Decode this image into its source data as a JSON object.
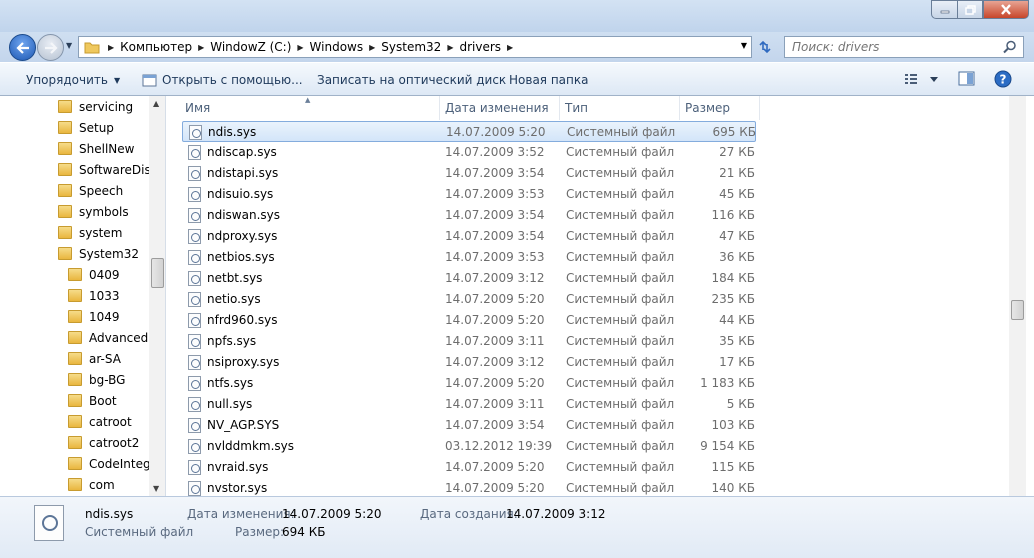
{
  "address": {
    "crumbs": [
      "Компьютер",
      "WindowZ (C:)",
      "Windows",
      "System32",
      "drivers"
    ]
  },
  "search": {
    "placeholder": "Поиск: drivers"
  },
  "toolbar": {
    "organize_label": "Упорядочить",
    "open_with_label": "Открыть с помощью...",
    "burn_label": "Записать на оптический диск",
    "new_folder_label": "Новая папка"
  },
  "nav_tree": [
    {
      "label": "servicing",
      "depth": 0
    },
    {
      "label": "Setup",
      "depth": 0
    },
    {
      "label": "ShellNew",
      "depth": 0
    },
    {
      "label": "SoftwareDistr",
      "depth": 0
    },
    {
      "label": "Speech",
      "depth": 0
    },
    {
      "label": "symbols",
      "depth": 0
    },
    {
      "label": "system",
      "depth": 0
    },
    {
      "label": "System32",
      "depth": 0
    },
    {
      "label": "0409",
      "depth": 1
    },
    {
      "label": "1033",
      "depth": 1
    },
    {
      "label": "1049",
      "depth": 1
    },
    {
      "label": "AdvancedIr",
      "depth": 1
    },
    {
      "label": "ar-SA",
      "depth": 1
    },
    {
      "label": "bg-BG",
      "depth": 1
    },
    {
      "label": "Boot",
      "depth": 1
    },
    {
      "label": "catroot",
      "depth": 1
    },
    {
      "label": "catroot2",
      "depth": 1
    },
    {
      "label": "CodeIntegr",
      "depth": 1
    },
    {
      "label": "com",
      "depth": 1
    }
  ],
  "columns": {
    "name": "Имя",
    "date": "Дата изменения",
    "type": "Тип",
    "size": "Размер"
  },
  "files": [
    {
      "name": "ndis.sys",
      "date": "14.07.2009 5:20",
      "type": "Системный файл",
      "size": "695 КБ",
      "selected": true
    },
    {
      "name": "ndiscap.sys",
      "date": "14.07.2009 3:52",
      "type": "Системный файл",
      "size": "27 КБ"
    },
    {
      "name": "ndistapi.sys",
      "date": "14.07.2009 3:54",
      "type": "Системный файл",
      "size": "21 КБ"
    },
    {
      "name": "ndisuio.sys",
      "date": "14.07.2009 3:53",
      "type": "Системный файл",
      "size": "45 КБ"
    },
    {
      "name": "ndiswan.sys",
      "date": "14.07.2009 3:54",
      "type": "Системный файл",
      "size": "116 КБ"
    },
    {
      "name": "ndproxy.sys",
      "date": "14.07.2009 3:54",
      "type": "Системный файл",
      "size": "47 КБ"
    },
    {
      "name": "netbios.sys",
      "date": "14.07.2009 3:53",
      "type": "Системный файл",
      "size": "36 КБ"
    },
    {
      "name": "netbt.sys",
      "date": "14.07.2009 3:12",
      "type": "Системный файл",
      "size": "184 КБ"
    },
    {
      "name": "netio.sys",
      "date": "14.07.2009 5:20",
      "type": "Системный файл",
      "size": "235 КБ"
    },
    {
      "name": "nfrd960.sys",
      "date": "14.07.2009 5:20",
      "type": "Системный файл",
      "size": "44 КБ"
    },
    {
      "name": "npfs.sys",
      "date": "14.07.2009 3:11",
      "type": "Системный файл",
      "size": "35 КБ"
    },
    {
      "name": "nsiproxy.sys",
      "date": "14.07.2009 3:12",
      "type": "Системный файл",
      "size": "17 КБ"
    },
    {
      "name": "ntfs.sys",
      "date": "14.07.2009 5:20",
      "type": "Системный файл",
      "size": "1 183 КБ"
    },
    {
      "name": "null.sys",
      "date": "14.07.2009 3:11",
      "type": "Системный файл",
      "size": "5 КБ"
    },
    {
      "name": "NV_AGP.SYS",
      "date": "14.07.2009 3:54",
      "type": "Системный файл",
      "size": "103 КБ"
    },
    {
      "name": "nvlddmkm.sys",
      "date": "03.12.2012 19:39",
      "type": "Системный файл",
      "size": "9 154 КБ"
    },
    {
      "name": "nvraid.sys",
      "date": "14.07.2009 5:20",
      "type": "Системный файл",
      "size": "115 КБ"
    },
    {
      "name": "nvstor.sys",
      "date": "14.07.2009 5:20",
      "type": "Системный файл",
      "size": "140 КБ"
    }
  ],
  "details": {
    "file_name": "ndis.sys",
    "file_type": "Системный файл",
    "modified_label": "Дата изменения:",
    "modified_value": "14.07.2009 5:20",
    "created_label": "Дата создания:",
    "created_value": "14.07.2009 3:12",
    "size_label": "Размер:",
    "size_value": "694 КБ"
  },
  "colors": {
    "selection": "#cce4f7",
    "toolbar_text": "#1e395b"
  }
}
